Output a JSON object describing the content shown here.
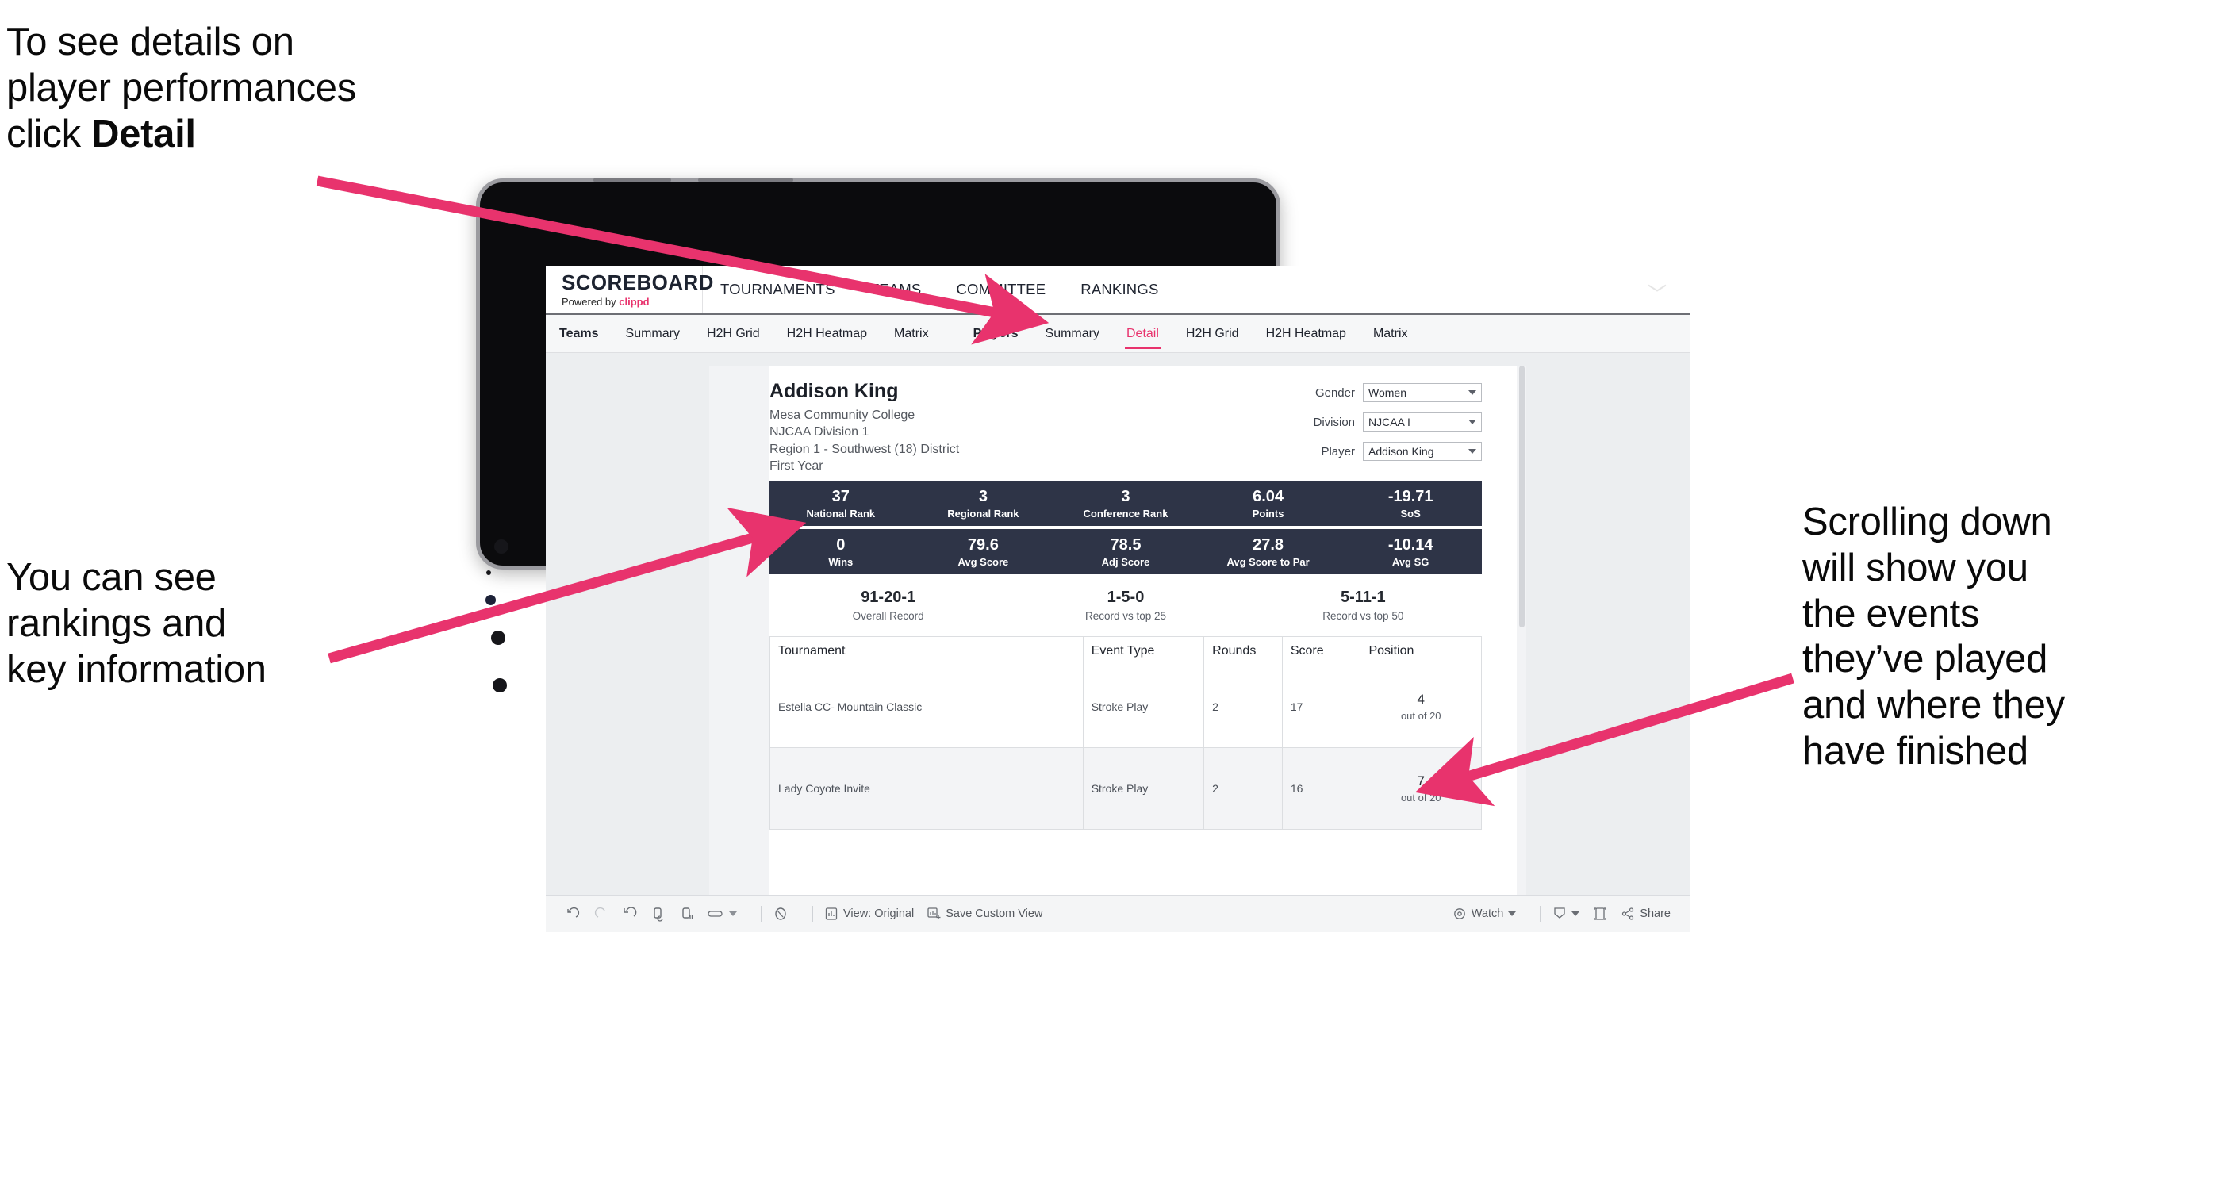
{
  "annotations": {
    "top_left": "To see details on\nplayer performances\nclick ",
    "top_left_bold": "Detail",
    "bottom_left": "You can see\nrankings and\nkey information",
    "right": "Scrolling down\nwill show you\nthe events\nthey’ve played\nand where they\nhave finished",
    "arrow_color": "#e8336d"
  },
  "app": {
    "brand": {
      "title": "SCOREBOARD",
      "powered_prefix": "Powered by ",
      "powered_brand": "clippd"
    },
    "top_nav": [
      {
        "label": "TOURNAMENTS"
      },
      {
        "label": "TEAMS"
      },
      {
        "label": "COMMITTEE"
      },
      {
        "label": "RANKINGS"
      }
    ],
    "sub_nav_left": [
      {
        "label": "Teams",
        "bold": true
      },
      {
        "label": "Summary"
      },
      {
        "label": "H2H Grid"
      },
      {
        "label": "H2H Heatmap"
      },
      {
        "label": "Matrix"
      }
    ],
    "sub_nav_right": [
      {
        "label": "Players",
        "bold": true
      },
      {
        "label": "Summary"
      },
      {
        "label": "Detail",
        "active": true
      },
      {
        "label": "H2H Grid"
      },
      {
        "label": "H2H Heatmap"
      },
      {
        "label": "Matrix"
      }
    ],
    "accent_color": "#e8336d",
    "statbar_color": "#2e3447"
  },
  "player": {
    "name": "Addison King",
    "school": "Mesa Community College",
    "division": "NJCAA Division 1",
    "region": "Region 1 - Southwest (18) District",
    "year": "First Year"
  },
  "filters": [
    {
      "label": "Gender",
      "value": "Women"
    },
    {
      "label": "Division",
      "value": "NJCAA I"
    },
    {
      "label": "Player",
      "value": "Addison King"
    }
  ],
  "stats_row_1": [
    {
      "value": "37",
      "label": "National Rank"
    },
    {
      "value": "3",
      "label": "Regional Rank"
    },
    {
      "value": "3",
      "label": "Conference Rank"
    },
    {
      "value": "6.04",
      "label": "Points"
    },
    {
      "value": "-19.71",
      "label": "SoS"
    }
  ],
  "stats_row_2": [
    {
      "value": "0",
      "label": "Wins"
    },
    {
      "value": "79.6",
      "label": "Avg Score"
    },
    {
      "value": "78.5",
      "label": "Adj Score"
    },
    {
      "value": "27.8",
      "label": "Avg Score to Par"
    },
    {
      "value": "-10.14",
      "label": "Avg SG"
    }
  ],
  "records": [
    {
      "value": "91-20-1",
      "label": "Overall Record"
    },
    {
      "value": "1-5-0",
      "label": "Record vs top 25"
    },
    {
      "value": "5-11-1",
      "label": "Record vs top 50"
    }
  ],
  "events_table": {
    "columns": [
      "Tournament",
      "Event Type",
      "Rounds",
      "Score",
      "Position"
    ],
    "rows": [
      {
        "tournament": "Estella CC- Mountain Classic",
        "event_type": "Stroke Play",
        "rounds": "2",
        "score": "17",
        "position_num": "4",
        "position_of": "out of 20"
      },
      {
        "tournament": "Lady Coyote Invite",
        "event_type": "Stroke Play",
        "rounds": "2",
        "score": "16",
        "position_num": "7",
        "position_of": "out of 20"
      }
    ]
  },
  "toolbar": {
    "view_label": "View: Original",
    "save_label": "Save Custom View",
    "watch_label": "Watch",
    "share_label": "Share"
  }
}
